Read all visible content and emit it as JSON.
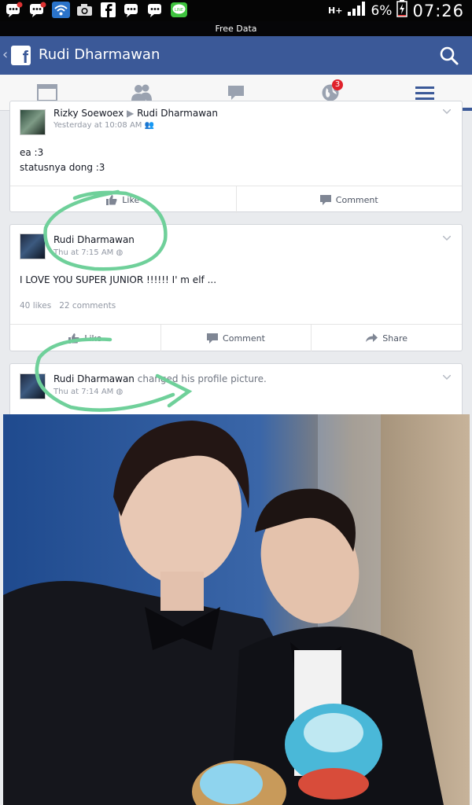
{
  "status_bar": {
    "battery": "6%",
    "network": "H+",
    "time": "07:26"
  },
  "banner": {
    "text": "Free Data"
  },
  "header": {
    "title": "Rudi Dharmawan",
    "brand_color": "#3b5998"
  },
  "nav": {
    "tabs": [
      {
        "icon": "news-feed-icon"
      },
      {
        "icon": "friends-icon"
      },
      {
        "icon": "messages-icon"
      },
      {
        "icon": "notifications-globe-icon",
        "badge": "3"
      },
      {
        "icon": "menu-icon"
      }
    ]
  },
  "posts": [
    {
      "author": "Rizky Soewoex",
      "target": "Rudi Dharmawan",
      "time": "Yesterday at 10:08 AM",
      "text_lines": [
        "ea :3",
        "statusnya dong :3"
      ],
      "actions": [
        "Like",
        "Comment"
      ]
    },
    {
      "author": "Rudi Dharmawan",
      "time": "Thu at 7:15 AM",
      "text": "I LOVE YOU SUPER JUNIOR !!!!!! I' m elf ...",
      "likes": "40 likes",
      "comments": "22 comments",
      "actions": [
        "Like",
        "Comment",
        "Share"
      ]
    },
    {
      "author": "Rudi Dharmawan",
      "action_text": "changed his profile picture.",
      "time": "Thu at 7:14 AM"
    }
  ],
  "annotation_color": "#6fd09a"
}
